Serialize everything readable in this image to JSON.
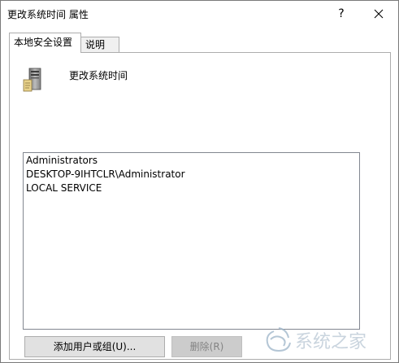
{
  "window": {
    "title": "更改系统时间 属性",
    "help_label": "?"
  },
  "tabs": [
    {
      "label": "本地安全设置",
      "active": true
    },
    {
      "label": "说明",
      "active": false
    }
  ],
  "policy": {
    "name": "更改系统时间",
    "icon": "server-computer-icon"
  },
  "users": [
    "Administrators",
    "DESKTOP-9IHTCLR\\Administrator",
    "LOCAL SERVICE"
  ],
  "buttons": {
    "add_label": "添加用户或组(U)...",
    "remove_label": "删除(R)",
    "remove_enabled": false
  },
  "watermark": {
    "text": "系统之家"
  }
}
